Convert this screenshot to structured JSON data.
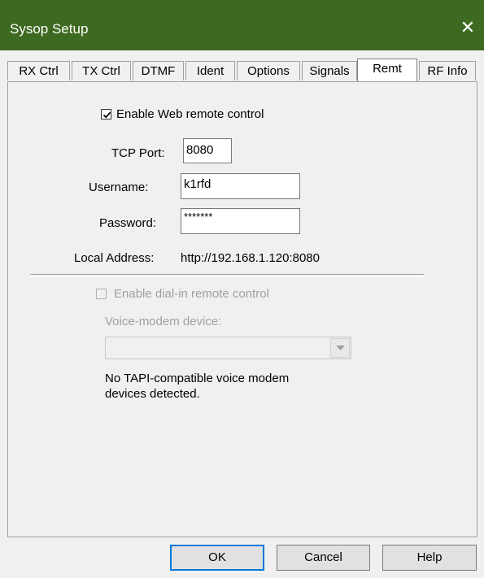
{
  "window": {
    "title": "Sysop Setup",
    "close_glyph": "✕"
  },
  "tabs": [
    {
      "label": "RX Ctrl"
    },
    {
      "label": "TX Ctrl"
    },
    {
      "label": "DTMF"
    },
    {
      "label": "Ident"
    },
    {
      "label": "Options"
    },
    {
      "label": "Signals"
    },
    {
      "label": "Remt",
      "active": true
    },
    {
      "label": "RF Info"
    }
  ],
  "web_remote": {
    "enable_label": "Enable Web remote control",
    "enabled": true,
    "tcp_port_label": "TCP Port:",
    "tcp_port_value": "8080",
    "username_label": "Username:",
    "username_value": "k1rfd",
    "password_label": "Password:",
    "password_value": "*******",
    "local_address_label": "Local Address:",
    "local_address_value": "http://192.168.1.120:8080"
  },
  "dial_in": {
    "enable_label": "Enable dial-in remote control",
    "enabled": false,
    "voice_modem_label": "Voice-modem device:",
    "voice_modem_value": "",
    "no_device_line1": "No TAPI-compatible voice modem",
    "no_device_line2": "devices detected."
  },
  "buttons": {
    "ok": "OK",
    "cancel": "Cancel",
    "help": "Help"
  },
  "colors": {
    "titlebar": "#3d6a20",
    "focus_border": "#0078d7"
  }
}
